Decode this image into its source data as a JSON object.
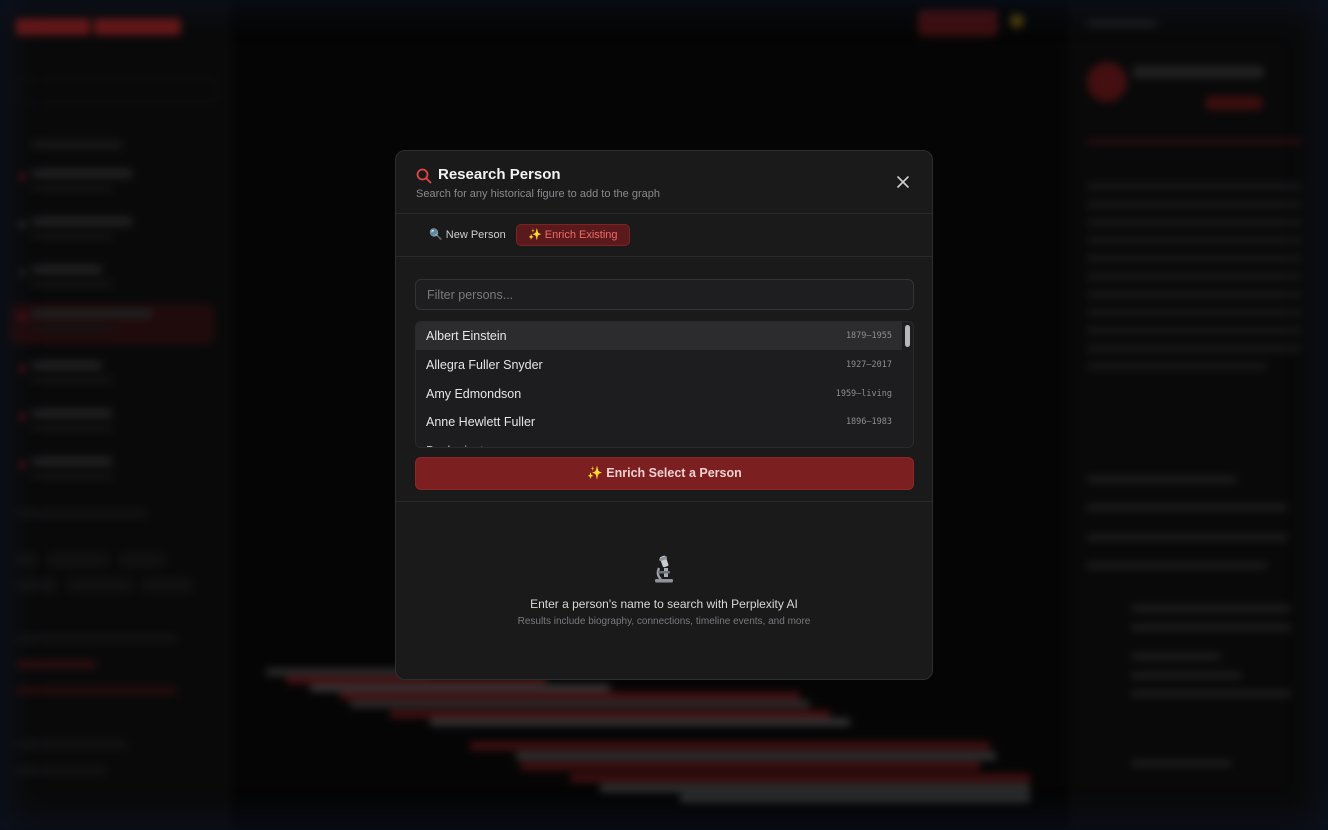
{
  "modal": {
    "title": "Research Person",
    "subtitle": "Search for any historical figure to add to the graph",
    "tabs": [
      {
        "icon": "🔍",
        "label": "New Person",
        "active": false
      },
      {
        "icon": "✨",
        "label": "Enrich Existing",
        "active": true
      }
    ],
    "filter": {
      "placeholder": "Filter persons...",
      "value": ""
    },
    "persons": [
      {
        "name": "Albert Einstein",
        "dates": "1879–1955"
      },
      {
        "name": "Allegra Fuller Snyder",
        "dates": "1927–2017"
      },
      {
        "name": "Amy Edmondson",
        "dates": "1959–living"
      },
      {
        "name": "Anne Hewlett Fuller",
        "dates": "1896–1983"
      }
    ],
    "enrich_button": "✨ Enrich Select a Person",
    "empty_state": {
      "icon": "microscope-icon",
      "title": "Enter a person's name to search with Perplexity AI",
      "subtitle": "Results include biography, connections, timeline events, and more"
    }
  },
  "colors": {
    "accent": "#7c1f21",
    "accent_text": "#f06a6a",
    "modal_bg": "#1a1a1b",
    "page_bg": "#0b0b0c"
  }
}
